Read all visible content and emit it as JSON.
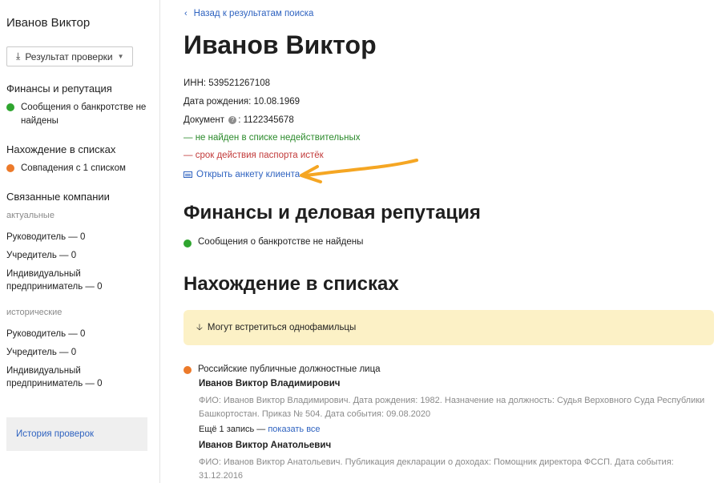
{
  "sidebar": {
    "name": "Иванов Виктор",
    "result_button": "Результат проверки",
    "finance": {
      "heading": "Финансы и репутация",
      "status": "Сообщения о банкротстве не найдены"
    },
    "lists": {
      "heading": "Нахождение в списках",
      "status": "Совпадения с 1 списком"
    },
    "companies": {
      "heading": "Связанные компании",
      "actual_label": "актуальные",
      "actual": [
        "Руководитель — 0",
        "Учредитель — 0",
        "Индивидуальный предприниматель — 0"
      ],
      "historic_label": "исторические",
      "historic": [
        "Руководитель — 0",
        "Учредитель — 0",
        "Индивидуальный предприниматель — 0"
      ]
    },
    "history_link": "История проверок"
  },
  "main": {
    "back_link": "Назад к результатам поиска",
    "title": "Иванов Виктор",
    "inn": "ИНН: 539521267108",
    "birth": "Дата рождения: 10.08.1969",
    "doc_label": "Документ",
    "doc_value": ": 1122345678",
    "doc_ok": "— не найден в списке недействительных",
    "doc_bad": "— срок действия паспорта истёк",
    "open_form": "Открыть анкету клиента",
    "finance_heading": "Финансы и деловая репутация",
    "finance_status": "Сообщения о банкротстве не найдены",
    "lists_heading": "Нахождение в списках",
    "banner": "Могут встретиться однофамильцы",
    "list_name": "Российские публичные должностные лица",
    "entries": [
      {
        "person": "Иванов Виктор Владимирович",
        "desc": "ФИО: Иванов Виктор Владимирович. Дата рождения: 1982. Назначение на должность: Судья Верховного Суда Республики Башкортостан. Приказ № 504. Дата события: 09.08.2020"
      },
      {
        "person": "Иванов Виктор Анатольевич",
        "desc": "ФИО: Иванов Виктор Анатольевич. Публикация декларации о доходах: Помощник директора ФССП. Дата события: 31.12.2016"
      }
    ],
    "more_prefix": "Ещё 1 запись — ",
    "more_link": "показать все"
  },
  "colors": {
    "link": "#2f63c0",
    "ok": "#2b8a2b",
    "bad": "#c23a3a",
    "green_dot": "#2fa52f",
    "orange_dot": "#ec7a2a",
    "banner_bg": "#fcf1c6",
    "annotation_arrow": "#f5a623"
  },
  "icons": {
    "download": "download-icon",
    "chevron": "chevron-down-icon",
    "back": "chevron-left-icon",
    "help": "question-icon",
    "form": "card-icon",
    "banner_arrow": "arrow-down-icon"
  }
}
